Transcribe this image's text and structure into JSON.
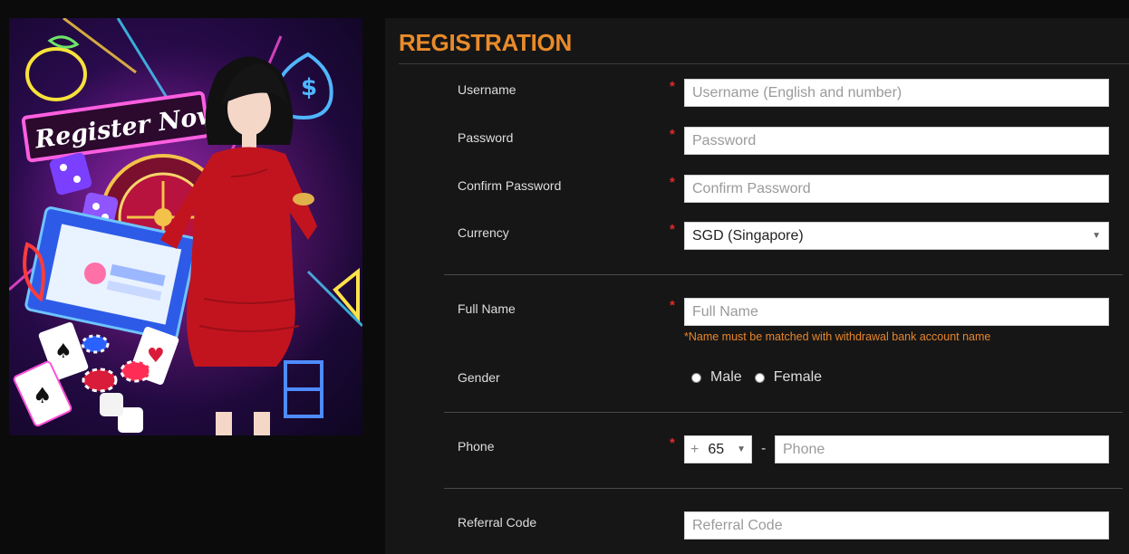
{
  "banner": {
    "headline": "Register Now"
  },
  "registration": {
    "title": "REGISTRATION",
    "required_mark": "*",
    "username": {
      "label": "Username",
      "placeholder": "Username (English and number)"
    },
    "password": {
      "label": "Password",
      "placeholder": "Password"
    },
    "confirm_password": {
      "label": "Confirm Password",
      "placeholder": "Confirm Password"
    },
    "currency": {
      "label": "Currency",
      "value": "SGD (Singapore)"
    },
    "full_name": {
      "label": "Full Name",
      "placeholder": "Full Name",
      "hint": "*Name must be matched with withdrawal bank account name"
    },
    "gender": {
      "label": "Gender",
      "options": [
        "Male",
        "Female"
      ]
    },
    "phone": {
      "label": "Phone",
      "plus": "+",
      "country_code": "65",
      "separator": "-",
      "placeholder": "Phone"
    },
    "referral": {
      "label": "Referral Code",
      "placeholder": "Referral Code"
    }
  },
  "colors": {
    "accent": "#e98b2a",
    "required": "#e22a2a",
    "panel_bg": "#171616",
    "page_bg": "#0b0b0b"
  },
  "icons": [
    "lemon-icon",
    "money-bag-icon",
    "dice-icon",
    "roulette-wheel-icon",
    "laptop-icon",
    "playing-cards-icon",
    "poker-chips-icon",
    "caret-down-icon"
  ]
}
